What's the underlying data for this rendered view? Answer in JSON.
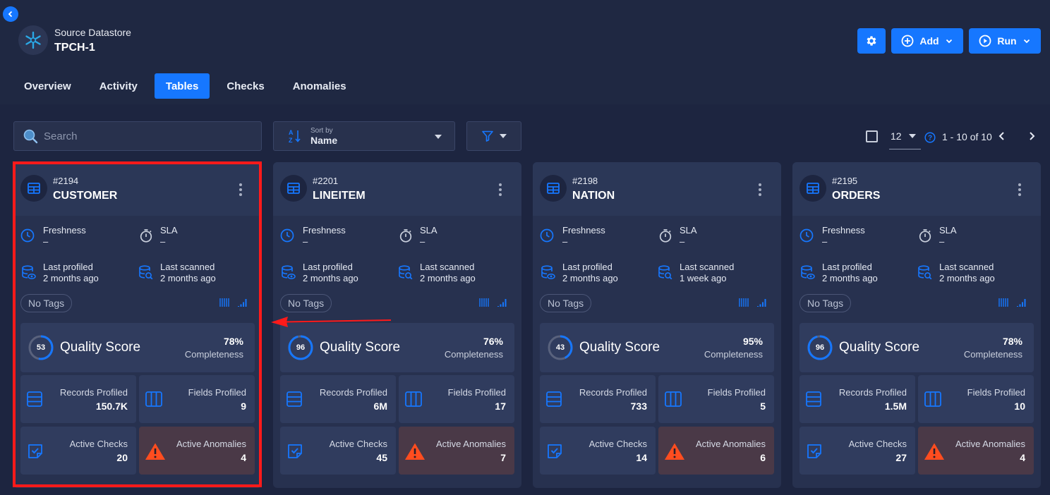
{
  "header": {
    "subtitle": "Source Datastore",
    "title": "TPCH-1",
    "settings_icon": "gear-icon",
    "add_label": "Add",
    "run_label": "Run"
  },
  "tabs": [
    {
      "label": "Overview",
      "active": false
    },
    {
      "label": "Activity",
      "active": false
    },
    {
      "label": "Tables",
      "active": true
    },
    {
      "label": "Checks",
      "active": false
    },
    {
      "label": "Anomalies",
      "active": false
    }
  ],
  "toolbar": {
    "search_placeholder": "Search",
    "sort_label": "Sort by",
    "sort_value": "Name",
    "per_page": "12",
    "range": "1 - 10 of 10"
  },
  "labels": {
    "freshness": "Freshness",
    "sla": "SLA",
    "last_profiled": "Last profiled",
    "last_scanned": "Last scanned",
    "no_tags": "No Tags",
    "quality_score": "Quality Score",
    "completeness": "Completeness",
    "records_profiled": "Records Profiled",
    "fields_profiled": "Fields Profiled",
    "active_checks": "Active Checks",
    "active_anomalies": "Active Anomalies"
  },
  "colors": {
    "accent": "#1677ff",
    "background": "#1d2540",
    "card": "#27314f",
    "anomaly_tile": "#4a3947",
    "warning": "#ff4d1f",
    "highlight": "#ff1a1a"
  },
  "cards": [
    {
      "id": "#2194",
      "name": "CUSTOMER",
      "freshness": "–",
      "sla": "–",
      "last_profiled": "2 months ago",
      "last_scanned": "2 months ago",
      "score": "53",
      "score_fraction": 0.53,
      "completeness": "78%",
      "records": "150.7K",
      "fields": "9",
      "checks": "20",
      "anomalies": "4"
    },
    {
      "id": "#2201",
      "name": "LINEITEM",
      "freshness": "–",
      "sla": "–",
      "last_profiled": "2 months ago",
      "last_scanned": "2 months ago",
      "score": "96",
      "score_fraction": 0.96,
      "completeness": "76%",
      "records": "6M",
      "fields": "17",
      "checks": "45",
      "anomalies": "7"
    },
    {
      "id": "#2198",
      "name": "NATION",
      "freshness": "–",
      "sla": "–",
      "last_profiled": "2 months ago",
      "last_scanned": "1 week ago",
      "score": "43",
      "score_fraction": 0.43,
      "completeness": "95%",
      "records": "733",
      "fields": "5",
      "checks": "14",
      "anomalies": "6"
    },
    {
      "id": "#2195",
      "name": "ORDERS",
      "freshness": "–",
      "sla": "–",
      "last_profiled": "2 months ago",
      "last_scanned": "2 months ago",
      "score": "96",
      "score_fraction": 0.96,
      "completeness": "78%",
      "records": "1.5M",
      "fields": "10",
      "checks": "27",
      "anomalies": "4"
    }
  ]
}
